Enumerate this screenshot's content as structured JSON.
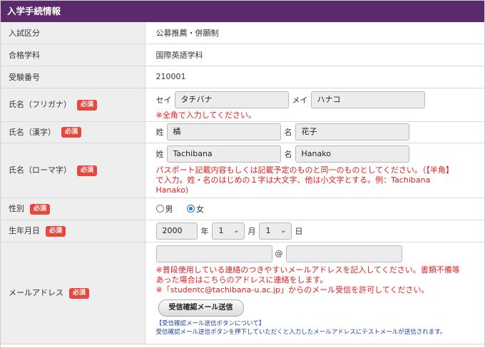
{
  "header": {
    "title": "入学手続情報"
  },
  "required_badge": "必須",
  "rows": {
    "exam_type": {
      "label": "入試区分",
      "value": "公募推薦・併願制"
    },
    "department": {
      "label": "合格学科",
      "value": "国際英語学科"
    },
    "exam_number": {
      "label": "受験番号",
      "value": "210001"
    },
    "name_kana": {
      "label": "氏名（フリガナ）",
      "sei_label": "セイ",
      "sei_value": "タチバナ",
      "mei_label": "メイ",
      "mei_value": "ハナコ",
      "note": "※全角で入力してください。"
    },
    "name_kanji": {
      "label": "氏名（漢字）",
      "sei_label": "姓",
      "sei_value": "橘",
      "mei_label": "名",
      "mei_value": "花子"
    },
    "name_roman": {
      "label": "氏名（ローマ字）",
      "sei_label": "姓",
      "sei_value": "Tachibana",
      "mei_label": "名",
      "mei_value": "Hanako",
      "note_line1": "パスポート記載内容もしくは記載予定のものと同一のものとしてください。（【半角】",
      "note_line2": "で入力。姓・名のはじめの１字は大文字、他は小文字とする。例：Tachibana",
      "note_line3": "Hanako)"
    },
    "gender": {
      "label": "性別",
      "option_male": "男",
      "option_female": "女",
      "selected": "女"
    },
    "birthdate": {
      "label": "生年月日",
      "year": "2000",
      "year_unit": "年",
      "month": "1",
      "month_unit": "月",
      "day": "1",
      "day_unit": "日"
    },
    "email": {
      "label": "メールアドレス",
      "at": "@",
      "local_value": "",
      "domain_value": "",
      "note_line1": "※普段使用している連絡のつきやすいメールアドレスを記入してください。書類不備等",
      "note_line2": "あった場合はこちらのアドレスに連絡をします。",
      "note_line3": "※「studentc@tachibana-u.ac.jp」からのメール受信を許可してください。",
      "button_label": "受信確認メール送信",
      "info_title": "【受信確認メール送信ボタンについて】",
      "info_text": "受信確認メール送信ボタンを押下していただくと入力したメールアドレスにテストメールが送信されます。"
    }
  }
}
